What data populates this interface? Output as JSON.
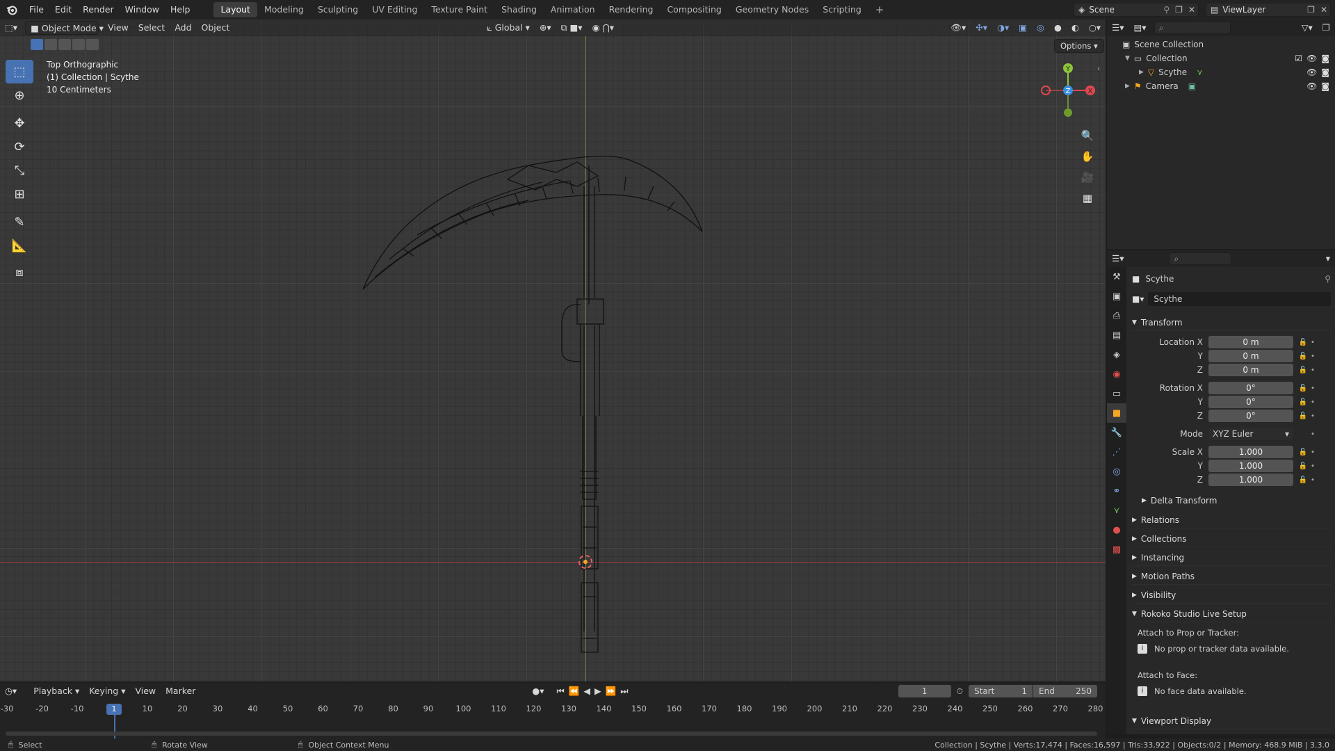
{
  "menu": {
    "file": "File",
    "edit": "Edit",
    "render": "Render",
    "window": "Window",
    "help": "Help"
  },
  "workspaces": [
    "Layout",
    "Modeling",
    "Sculpting",
    "UV Editing",
    "Texture Paint",
    "Shading",
    "Animation",
    "Rendering",
    "Compositing",
    "Geometry Nodes",
    "Scripting"
  ],
  "scene": {
    "name": "Scene",
    "view_layer": "ViewLayer"
  },
  "viewport_header": {
    "mode": "Object Mode",
    "view": "View",
    "select": "Select",
    "add": "Add",
    "object": "Object",
    "orientation": "Global",
    "options": "Options"
  },
  "viewport_overlay": {
    "line1": "Top Orthographic",
    "line2": "(1) Collection | Scythe",
    "line3": "10 Centimeters"
  },
  "gizmo": {
    "x": "X",
    "y": "Y",
    "z": "Z"
  },
  "outliner": {
    "root": "Scene Collection",
    "items": [
      {
        "label": "Collection"
      },
      {
        "label": "Scythe"
      },
      {
        "label": "Camera"
      }
    ]
  },
  "properties": {
    "object_name": "Scythe",
    "datablock_name": "Scythe",
    "transform_title": "Transform",
    "location": {
      "label_x": "Location X",
      "label_y": "Y",
      "label_z": "Z",
      "x": "0 m",
      "y": "0 m",
      "z": "0 m"
    },
    "rotation": {
      "label_x": "Rotation X",
      "label_y": "Y",
      "label_z": "Z",
      "x": "0°",
      "y": "0°",
      "z": "0°"
    },
    "mode": {
      "label": "Mode",
      "value": "XYZ Euler"
    },
    "scale": {
      "label_x": "Scale X",
      "label_y": "Y",
      "label_z": "Z",
      "x": "1.000",
      "y": "1.000",
      "z": "1.000"
    },
    "delta_transform": "Delta Transform",
    "relations": "Relations",
    "collections": "Collections",
    "instancing": "Instancing",
    "motion_paths": "Motion Paths",
    "visibility": "Visibility",
    "rokoko": "Rokoko Studio Live Setup",
    "attach_prop": "Attach to Prop or Tracker:",
    "no_prop": "No prop or tracker data available.",
    "attach_face": "Attach to Face:",
    "no_face": "No face data available.",
    "viewport_display": "Viewport Display"
  },
  "timeline": {
    "playback": "Playback",
    "keying": "Keying",
    "view": "View",
    "marker": "Marker",
    "current_frame": "1",
    "start_label": "Start",
    "start": "1",
    "end_label": "End",
    "end": "250",
    "frame_marker": "1",
    "ticks": [
      "-30",
      "-20",
      "-10",
      "10",
      "20",
      "30",
      "40",
      "50",
      "60",
      "70",
      "80",
      "90",
      "100",
      "110",
      "120",
      "130",
      "140",
      "150",
      "160",
      "170",
      "180",
      "190",
      "200",
      "210",
      "220",
      "230",
      "240",
      "250",
      "260",
      "270",
      "280"
    ]
  },
  "statusbar": {
    "select": "Select",
    "rotate": "Rotate View",
    "context": "Object Context Menu",
    "stats": "Collection | Scythe | Verts:17,474 | Faces:16,597 | Tris:33,922 | Objects:0/2 | Memory: 468.9 MiB | 3.3.0"
  },
  "colors": {
    "accent": "#4772b3",
    "x_axis": "#e0474e",
    "y_axis": "#8cc639",
    "z_axis": "#3a90e0",
    "header_bg": "#232323",
    "viewport_bg": "#393939"
  }
}
